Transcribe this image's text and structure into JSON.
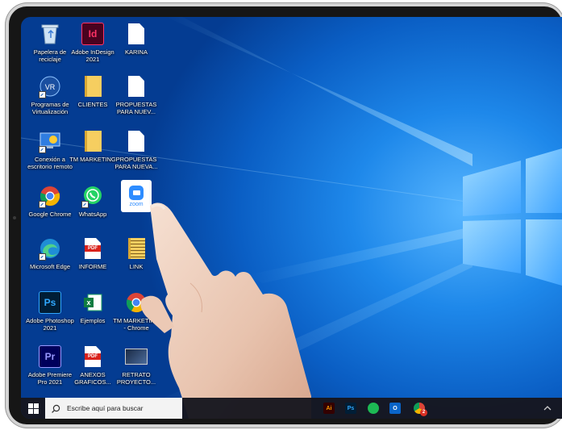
{
  "desktop": {
    "icons": [
      {
        "label": "Papelera de reciclaje",
        "icon": "recycle-bin-icon"
      },
      {
        "label": "Adobe InDesign 2021",
        "icon": "indesign-icon",
        "glyph": "Id",
        "color": "#d6173d"
      },
      {
        "label": "KARINA",
        "icon": "file-icon"
      },
      {
        "label": "Programas de Virtualización",
        "icon": "vr-icon",
        "glyph": "VR"
      },
      {
        "label": "CLIENTES",
        "icon": "folder-icon"
      },
      {
        "label": "PROPUESTAS PARA NUEV...",
        "icon": "file-icon"
      },
      {
        "label": "Conexión a escritorio remoto",
        "icon": "remote-desktop-icon"
      },
      {
        "label": "TM MARKETING",
        "icon": "folder-icon"
      },
      {
        "label": "PROPUESTAS PARA NUEVA...",
        "icon": "file-icon"
      },
      {
        "label": "Google Chrome",
        "icon": "chrome-icon"
      },
      {
        "label": "WhatsApp",
        "icon": "whatsapp-icon"
      },
      {
        "label": "Zoom",
        "icon": "zoom-icon",
        "glyph": "zoom"
      },
      {
        "label": "Microsoft Edge",
        "icon": "edge-icon"
      },
      {
        "label": "INFORME",
        "icon": "pdf-icon",
        "glyph": "PDF"
      },
      {
        "label": "LINK",
        "icon": "zip-folder-icon"
      },
      {
        "label": "Adobe Photoshop 2021",
        "icon": "photoshop-icon",
        "glyph": "Ps",
        "color": "#001e36"
      },
      {
        "label": "Ejemplos",
        "icon": "excel-icon",
        "glyph": "x"
      },
      {
        "label": "TM MARKETING - Chrome",
        "icon": "chrome-icon"
      },
      {
        "label": "Adobe Premiere Pro 2021",
        "icon": "premiere-icon",
        "glyph": "Pr",
        "color": "#00005b"
      },
      {
        "label": "ANEXOS GRAFICOS...",
        "icon": "pdf-icon",
        "glyph": "PDF"
      },
      {
        "label": "RETRATO PROYECTO...",
        "icon": "image-icon"
      }
    ]
  },
  "taskbar": {
    "search_placeholder": "Escribe aquí para buscar",
    "apps": [
      {
        "name": "illustrator-taskbar-icon",
        "glyph": "Ai",
        "color": "#330000",
        "fg": "#ff9a00"
      },
      {
        "name": "photoshop-taskbar-icon",
        "glyph": "Ps",
        "color": "#001e36",
        "fg": "#31a8ff"
      },
      {
        "name": "spotify-taskbar-icon",
        "glyph": "",
        "color": "#1db954",
        "fg": "#000"
      },
      {
        "name": "outlook-taskbar-icon",
        "glyph": "O",
        "color": "#0a64c8",
        "fg": "#fff"
      },
      {
        "name": "chrome-taskbar-icon",
        "glyph": "",
        "color": "#ffffff",
        "fg": "#000"
      }
    ],
    "notification_badge": "2"
  },
  "colors": {
    "wallpaper_accent": "#1e88ea",
    "taskbar_bg": "#16161e",
    "search_bg": "#f3f3f3"
  }
}
